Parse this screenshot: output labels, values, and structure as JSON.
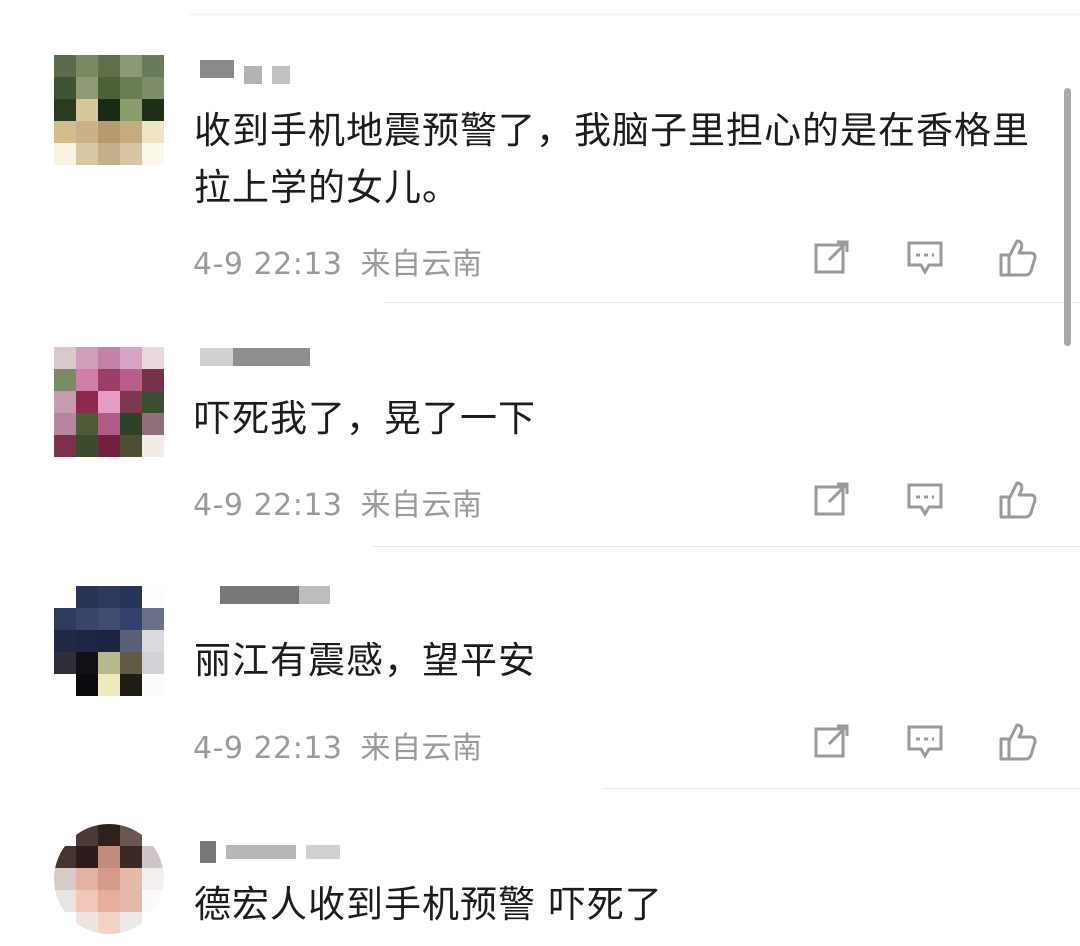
{
  "comments": [
    {
      "text": "收到手机地震预警了，我脑子里担心的是在香格里拉上学的女儿。",
      "time": "4-9 22:13",
      "location": "来自云南",
      "avatar_colors": [
        "#5c6b4c",
        "#7a8960",
        "#5f7048",
        "#8b9a74",
        "#6a7b59",
        "#3e5234",
        "#8f9b77",
        "#4d6139",
        "#6a7d55",
        "#7d8d67",
        "#2b3b1f",
        "#d6c79d",
        "#1b2a14",
        "#8a9b6c",
        "#1f2e17",
        "#d3bd8d",
        "#cbb189",
        "#b89a6e",
        "#c7ab80",
        "#efe4c4",
        "#f7f2e2",
        "#d8c7a3",
        "#c5ae8a",
        "#d8c5a4",
        "#fbf7ec"
      ]
    },
    {
      "text": "吓死我了，晃了一下",
      "time": "4-9 22:13",
      "location": "来自云南",
      "avatar_colors": [
        "#d9c9cb",
        "#cf9fb9",
        "#c282a7",
        "#d8a4c4",
        "#e7d8de",
        "#7c8b66",
        "#d17ea8",
        "#9b3e68",
        "#b95d8c",
        "#7b2f4b",
        "#c69bb0",
        "#8b2a4e",
        "#e59ec3",
        "#7d3952",
        "#3b4e30",
        "#b6869e",
        "#4e5c39",
        "#b05b87",
        "#2f3f26",
        "#8f6f7c",
        "#7e3249",
        "#3d4a2d",
        "#71203e",
        "#4e4d35",
        "#f2ece6"
      ]
    },
    {
      "text": "丽江有震感，望平安",
      "time": "4-9 22:13",
      "location": "来自云南",
      "avatar_colors": [
        "#ffffff",
        "#273455",
        "#2c3a5e",
        "#27345a",
        "#fdfdfd",
        "#2f3b5c",
        "#384568",
        "#3f4c70",
        "#34416a",
        "#6b7089",
        "#202845",
        "#1d2744",
        "#1b2541",
        "#5a5f78",
        "#d9dbe0",
        "#2e2f3b",
        "#101117",
        "#b6b98b",
        "#605b42",
        "#d2d3d7",
        "#ffffff",
        "#0b0b0d",
        "#f1eac0",
        "#1e1c14",
        "#fcfcfc"
      ]
    },
    {
      "text": "德宏人收到手机预警 吓死了",
      "avatar_colors": [
        "#ffffff",
        "#4a3936",
        "#2d201d",
        "#6a5551",
        "#ffffff",
        "#473431",
        "#2a1d1b",
        "#c18b7d",
        "#3a2925",
        "#cfc5c3",
        "#d6cbc7",
        "#e2b3a5",
        "#d69a8b",
        "#e6b9aa",
        "#f2efee",
        "#e9e3e1",
        "#f0c7b8",
        "#e7ad9d",
        "#e4b8a9",
        "#fbfafa",
        "#ffffff",
        "#eee4e0",
        "#f2d3c8",
        "#efe8e5",
        "#ffffff"
      ]
    }
  ],
  "icons": {
    "share": "share-icon",
    "comment": "comment-icon",
    "like": "thumbs-up-icon"
  }
}
